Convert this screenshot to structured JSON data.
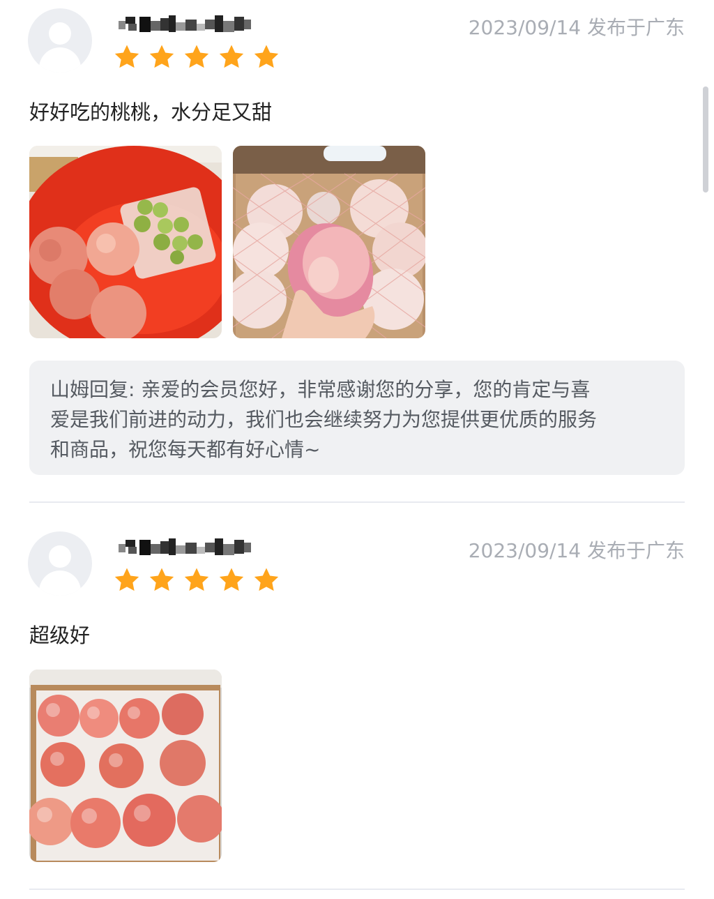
{
  "reviews": [
    {
      "username": "*******",
      "rating": 5,
      "date": "2023/09/14",
      "location": "发布于广东",
      "text": "好好吃的桃桃，水分足又甜",
      "photos": [
        "peaches-in-red-bowl-photo",
        "peach-held-over-box-photo"
      ],
      "reply": {
        "label": "山姆回复: ",
        "line1": "山姆回复: 亲爱的会员您好，非常感谢您的分享，您的肯定与喜",
        "line2": "爱是我们前进的动力，我们也会继续努力为您提供更优质的服务",
        "line3": "和商品，祝您每天都有好心情~"
      }
    },
    {
      "username": "*******",
      "rating": 5,
      "date": "2023/09/14",
      "location": "发布于广东",
      "text": "超级好",
      "photos": [
        "box-of-peaches-photo"
      ]
    }
  ],
  "colors": {
    "star": "#ffa41b",
    "meta": "#a9adb4",
    "reply_bg": "#f0f1f3",
    "divider": "#e8eaf0"
  }
}
